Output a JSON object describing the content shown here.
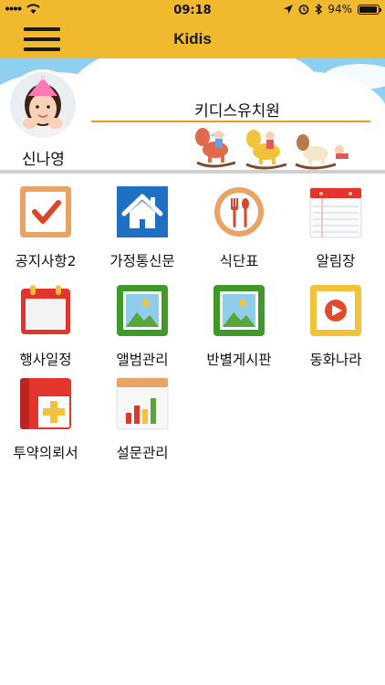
{
  "status_bar": {
    "time": "09:18",
    "battery": "94%",
    "battery_level": 0.94,
    "icons": [
      "signal-icon",
      "wifi-icon",
      "location-icon",
      "alarm-icon",
      "bluetooth-icon",
      "battery-icon"
    ]
  },
  "header": {
    "title": "Kidis",
    "menu_icon": "hamburger-menu-icon",
    "background_color": "#f0b92e"
  },
  "profile": {
    "user_name": "신나영",
    "school_name": "키디스유치원",
    "banner_color": "#8fd0f0"
  },
  "menu": {
    "items": [
      {
        "label": "공지사항2",
        "icon": "checkbox-icon"
      },
      {
        "label": "가정통신문",
        "icon": "home-icon"
      },
      {
        "label": "식단표",
        "icon": "fork-spoon-icon"
      },
      {
        "label": "알림장",
        "icon": "notebook-icon"
      },
      {
        "label": "행사일정",
        "icon": "calendar-icon"
      },
      {
        "label": "앨범관리",
        "icon": "photo-album-icon"
      },
      {
        "label": "반별게시판",
        "icon": "photo-board-icon"
      },
      {
        "label": "동화나라",
        "icon": "video-play-icon"
      },
      {
        "label": "투약의뢰서",
        "icon": "medicine-book-icon"
      },
      {
        "label": "설문관리",
        "icon": "bar-chart-icon"
      }
    ]
  }
}
